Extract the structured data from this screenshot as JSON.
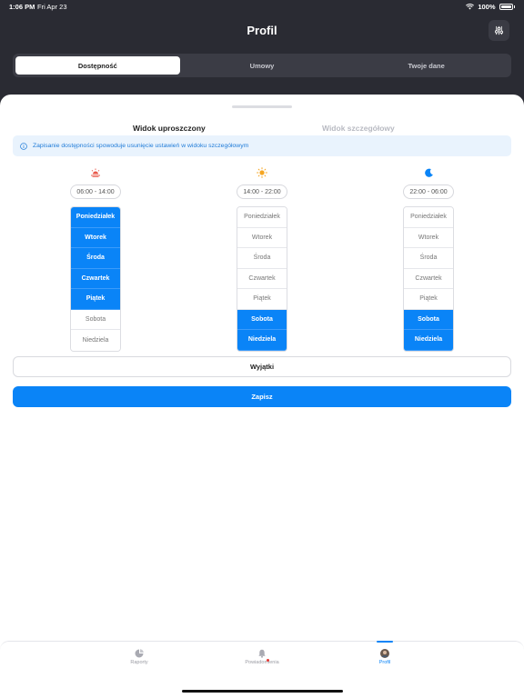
{
  "status": {
    "time": "1:06 PM",
    "date": "Fri Apr 23",
    "battery": "100%"
  },
  "header": {
    "title": "Profil",
    "filter_icon": "sliders-icon"
  },
  "segments": [
    {
      "label": "Dostępność",
      "active": true
    },
    {
      "label": "Umowy",
      "active": false
    },
    {
      "label": "Twoje dane",
      "active": false
    }
  ],
  "view_tabs": {
    "simple": "Widok uproszczony",
    "detailed": "Widok szczegółowy",
    "active": "simple"
  },
  "info": {
    "text": "Zapisanie dostępności spowoduje usunięcie ustawień w widoku szczegółowym",
    "icon": "info-icon"
  },
  "shifts": [
    {
      "icon": "sunrise-icon",
      "icon_color": "#e8584a",
      "time": "06:00 - 14:00",
      "days": [
        {
          "label": "Poniedziałek",
          "on": true
        },
        {
          "label": "Wtorek",
          "on": true
        },
        {
          "label": "Środa",
          "on": true
        },
        {
          "label": "Czwartek",
          "on": true
        },
        {
          "label": "Piątek",
          "on": true
        },
        {
          "label": "Sobota",
          "on": false
        },
        {
          "label": "Niedziela",
          "on": false
        }
      ]
    },
    {
      "icon": "sun-icon",
      "icon_color": "#f5a623",
      "time": "14:00 - 22:00",
      "days": [
        {
          "label": "Poniedziałek",
          "on": false
        },
        {
          "label": "Wtorek",
          "on": false
        },
        {
          "label": "Środa",
          "on": false
        },
        {
          "label": "Czwartek",
          "on": false
        },
        {
          "label": "Piątek",
          "on": false
        },
        {
          "label": "Sobota",
          "on": true
        },
        {
          "label": "Niedziela",
          "on": true
        }
      ]
    },
    {
      "icon": "moon-icon",
      "icon_color": "#0a84f7",
      "time": "22:00 - 06:00",
      "days": [
        {
          "label": "Poniedziałek",
          "on": false
        },
        {
          "label": "Wtorek",
          "on": false
        },
        {
          "label": "Środa",
          "on": false
        },
        {
          "label": "Czwartek",
          "on": false
        },
        {
          "label": "Piątek",
          "on": false
        },
        {
          "label": "Sobota",
          "on": true
        },
        {
          "label": "Niedziela",
          "on": true
        }
      ]
    }
  ],
  "buttons": {
    "exceptions": "Wyjątki",
    "save": "Zapisz"
  },
  "tabbar": [
    {
      "label": "Raporty",
      "icon": "pie-chart-icon",
      "active": false
    },
    {
      "label": "Powiadomienia",
      "icon": "bell-icon",
      "active": false
    },
    {
      "label": "Profil",
      "icon": "avatar",
      "active": true
    }
  ],
  "colors": {
    "accent": "#0a84f7",
    "header_bg": "#2a2b33"
  }
}
